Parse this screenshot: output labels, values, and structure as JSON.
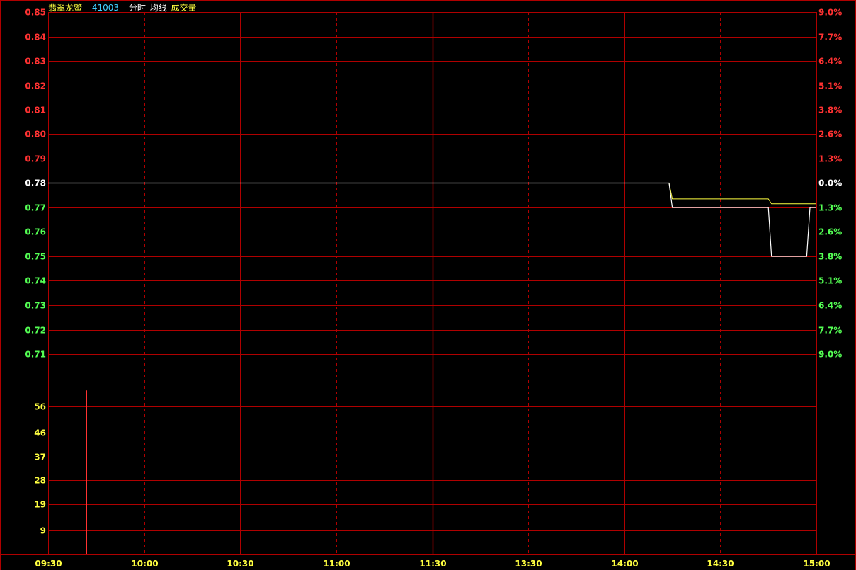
{
  "header": {
    "name": "翡翠龙鳖",
    "code": "41003",
    "tag_line": "分时",
    "tag_avg": "均线",
    "tag_vol": "成交量"
  },
  "colors": {
    "grid": "#b00000",
    "up": "#ff3232",
    "down": "#54ff54",
    "flat": "#ffffff",
    "price_line": "#ffffff",
    "avg_line": "#ffff40",
    "vol_up": "#ff3232",
    "vol_down": "#40d0ff",
    "vol_tick": "#ffff40",
    "time_tick": "#ffff40",
    "name": "#ffff40",
    "code": "#40d0ff",
    "tags": "#ffffff"
  },
  "chart_data": {
    "type": "line",
    "prev_close": 0.78,
    "price_ticks": [
      "0.85",
      "0.84",
      "0.83",
      "0.82",
      "0.81",
      "0.80",
      "0.79",
      "0.78",
      "0.77",
      "0.76",
      "0.75",
      "0.74",
      "0.73",
      "0.72",
      "0.71"
    ],
    "pct_ticks": [
      "9.0%",
      "7.7%",
      "6.4%",
      "5.1%",
      "3.8%",
      "2.6%",
      "1.3%",
      "0.0%",
      "1.3%",
      "2.6%",
      "3.8%",
      "5.1%",
      "6.4%",
      "7.7%",
      "9.0%"
    ],
    "price_range": [
      0.71,
      0.85
    ],
    "volume_ticks": [
      "56",
      "46",
      "37",
      "28",
      "19",
      "9"
    ],
    "volume_range": [
      0,
      65
    ],
    "time_ticks": [
      "09:30",
      "10:00",
      "10:30",
      "11:00",
      "11:30",
      "13:30",
      "14:00",
      "14:30",
      "15:00"
    ],
    "total_minutes": 240,
    "price_series": {
      "name": "分时",
      "points": [
        [
          0,
          0.78
        ],
        [
          194,
          0.78
        ],
        [
          195,
          0.77
        ],
        [
          225,
          0.77
        ],
        [
          226,
          0.75
        ],
        [
          237,
          0.75
        ],
        [
          238,
          0.77
        ],
        [
          240,
          0.77
        ]
      ]
    },
    "avg_series": {
      "name": "均线",
      "points": [
        [
          0,
          0.78
        ],
        [
          194,
          0.78
        ],
        [
          195,
          0.7735
        ],
        [
          225,
          0.7735
        ],
        [
          226,
          0.7715
        ],
        [
          240,
          0.7715
        ]
      ]
    },
    "volume_bars": [
      {
        "minute": 12,
        "volume": 62,
        "dir": "up"
      },
      {
        "minute": 195,
        "volume": 35,
        "dir": "down"
      },
      {
        "minute": 226,
        "volume": 19,
        "dir": "down"
      }
    ]
  }
}
